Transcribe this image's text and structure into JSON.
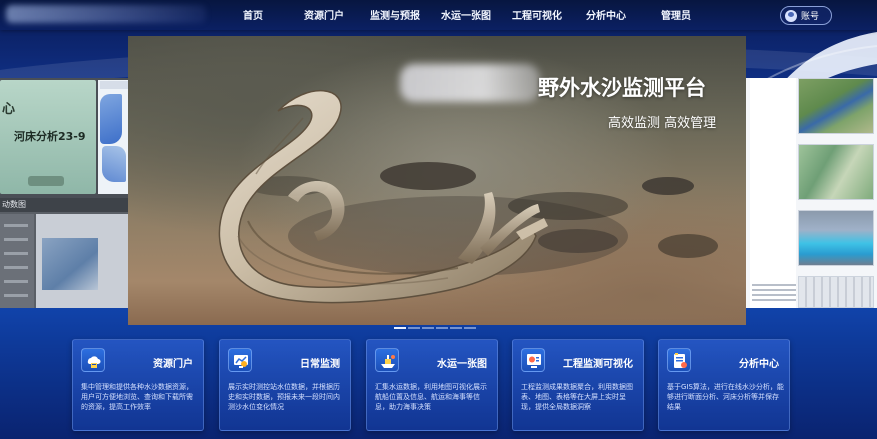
{
  "nav": {
    "items": [
      "首页",
      "资源门户",
      "监测与预报",
      "水运一张图",
      "工程可视化",
      "分析中心",
      "管理员"
    ],
    "account_label": "账号"
  },
  "hero": {
    "title": "野外水沙监测平台",
    "subtitle": "高效监测 高效管理",
    "slide_count": 6,
    "active_slide": 1
  },
  "side_left": {
    "big_text": "心",
    "card_title": "河床分析23-9",
    "map_header": "动数图"
  },
  "cards": [
    {
      "title": "资源门户",
      "desc": "集中管理和提供各种水沙数据资源，用户可方便地浏览、查询和下载所需的资源，提高工作效率",
      "icon": "archive-cloud-icon"
    },
    {
      "title": "日常监测",
      "desc": "展示实时测控站水位数据，并根据历史和实时数据，预报未来一段时间内测沙水位变化情况",
      "icon": "map-monitor-icon"
    },
    {
      "title": "水运一张图",
      "desc": "汇集水运数据，利用地图可视化展示航船位置及信息、航运和海事等信息，助力海事决策",
      "icon": "ship-map-icon"
    },
    {
      "title": "工程监测可视化",
      "desc": "工程监测成果数据聚合，利用数据图表、地图、表格等在大屏上实时呈现，提供全局数据洞察",
      "icon": "dashboard-screen-icon"
    },
    {
      "title": "分析中心",
      "desc": "基于GIS算法，进行在线水沙分析，能够进行断面分析、河床分析等并保存结果",
      "icon": "analysis-doc-icon"
    }
  ],
  "colors": {
    "nav_bg": "#071640",
    "page_bg": "#1655c9",
    "card_bg": "#1b4fb8",
    "text": "#ffffff"
  }
}
